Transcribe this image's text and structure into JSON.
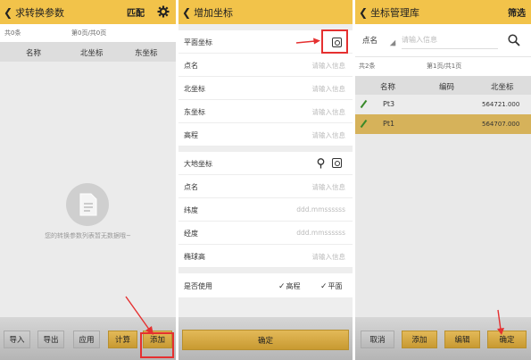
{
  "panel1": {
    "title": "求转换参数",
    "match_label": "匹配",
    "count_text": "共0条",
    "page_text": "第0页/共0页",
    "columns": [
      "名称",
      "北坐标",
      "东坐标"
    ],
    "empty_text": "您的转换参数列表暂无数据哦~",
    "buttons": [
      "导入",
      "导出",
      "应用",
      "计算",
      "添加"
    ]
  },
  "panel2": {
    "title": "增加坐标",
    "plane_section": "平面坐标",
    "plane_fields": [
      {
        "label": "点名",
        "placeholder": "请输入信息"
      },
      {
        "label": "北坐标",
        "placeholder": "请输入信息"
      },
      {
        "label": "东坐标",
        "placeholder": "请输入信息"
      },
      {
        "label": "高程",
        "placeholder": "请输入信息"
      }
    ],
    "geo_section": "大地坐标",
    "geo_fields": [
      {
        "label": "点名",
        "placeholder": "请输入信息"
      },
      {
        "label": "纬度",
        "placeholder": "ddd.mmssssss"
      },
      {
        "label": "经度",
        "placeholder": "ddd.mmssssss"
      },
      {
        "label": "椭球高",
        "placeholder": "请输入信息"
      }
    ],
    "use_label": "是否使用",
    "use_options": [
      {
        "label": "高程",
        "checked": true
      },
      {
        "label": "平面",
        "checked": true
      }
    ],
    "confirm_label": "确定"
  },
  "panel3": {
    "title": "坐标管理库",
    "filter_label": "筛选",
    "select_value": "点名",
    "search_placeholder": "请输入信息",
    "count_text": "共2条",
    "page_text": "第1页/共1页",
    "columns": [
      "名称",
      "编码",
      "北坐标"
    ],
    "rows": [
      {
        "name": "Pt3",
        "code": "",
        "north": "564721.000",
        "selected": false
      },
      {
        "name": "Pt1",
        "code": "",
        "north": "564707.000",
        "selected": true
      }
    ],
    "buttons": [
      "取消",
      "添加",
      "编辑",
      "确定"
    ]
  },
  "colors": {
    "header": "#f2c34a",
    "selected_row": "#d6b25a",
    "highlight": "#e53030"
  }
}
